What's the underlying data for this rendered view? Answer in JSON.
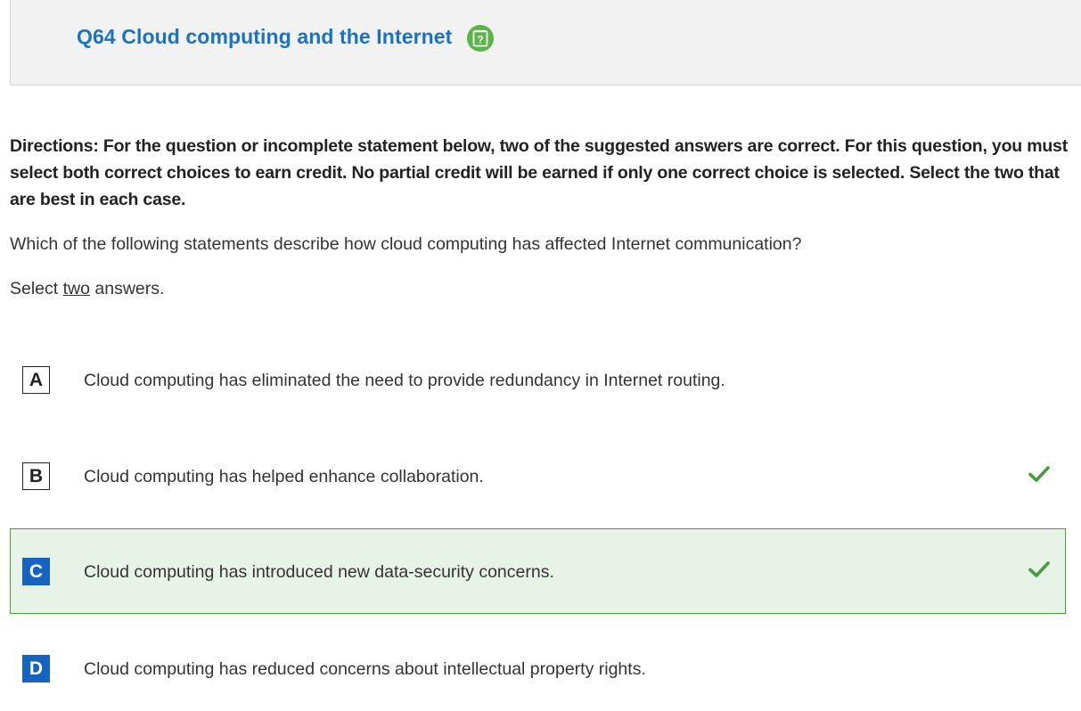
{
  "header": {
    "title": "Q64 Cloud computing and the Internet",
    "help_icon": "question-mark-icon",
    "help_icon_color": "#5bb446",
    "title_color": "#1a73c1"
  },
  "directions": "Directions: For the question or incomplete statement below, two of the suggested answers are correct. For this question, you must select both correct choices to earn credit. No partial credit will be earned if only one correct choice is selected. Select the two that are best in each case.",
  "question": "Which of the following statements describe how cloud computing has affected Internet communication?",
  "select_instruction": {
    "before": "Select ",
    "emphasis": "two",
    "after": " answers."
  },
  "choices": [
    {
      "letter": "A",
      "text": "Cloud computing has eliminated the need to provide redundancy in Internet routing.",
      "selected": false,
      "correct": false
    },
    {
      "letter": "B",
      "text": "Cloud computing has helped enhance collaboration.",
      "selected": false,
      "correct": true
    },
    {
      "letter": "C",
      "text": "Cloud computing has introduced new data-security concerns.",
      "selected": true,
      "correct": true
    },
    {
      "letter": "D",
      "text": "Cloud computing has reduced concerns about intellectual property rights.",
      "selected": true,
      "correct": false
    }
  ],
  "colors": {
    "selected_letter_bg": "#1565c0",
    "selected_row_bg": "#e8f3e7",
    "selected_row_border": "#4a9a42",
    "check": "#4a9a42"
  }
}
